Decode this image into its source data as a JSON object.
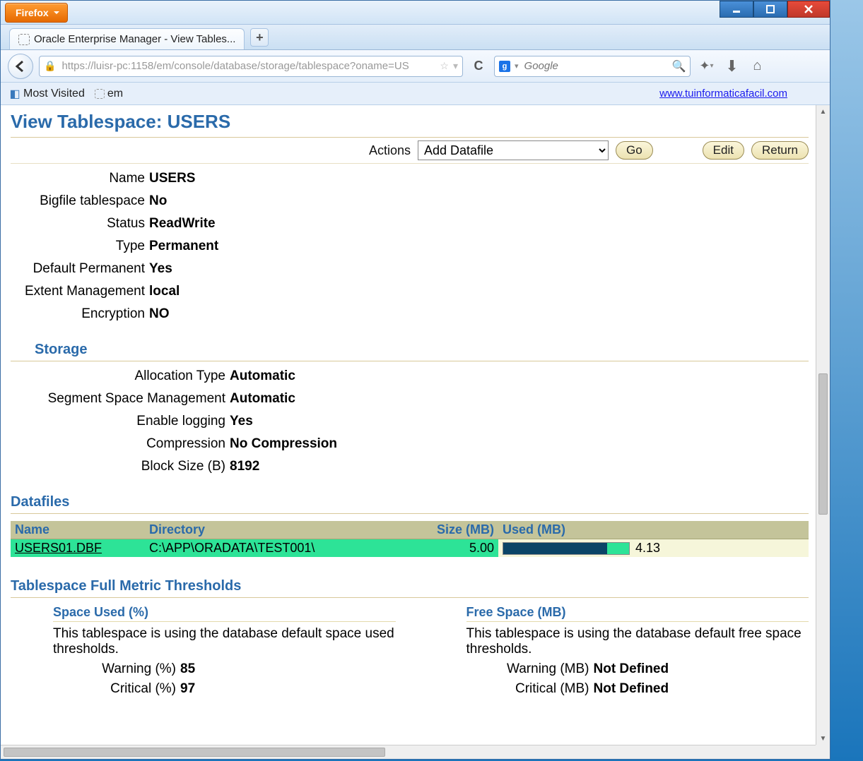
{
  "browser": {
    "menu_button": "Firefox",
    "tab_title": "Oracle Enterprise Manager - View Tables...",
    "url_display": "https://luisr-pc:1158/em/console/database/storage/tablespace?oname=US",
    "search_placeholder": "Google",
    "bookmarks": {
      "most_visited": "Most Visited",
      "em": "em"
    },
    "promo_link": "www.tuinformaticafacil.com"
  },
  "page": {
    "title": "View Tablespace: USERS",
    "actions_label": "Actions",
    "actions_selected": "Add Datafile",
    "btn_go": "Go",
    "btn_edit": "Edit",
    "btn_return": "Return",
    "general": {
      "name_label": "Name",
      "name_value": "USERS",
      "bigfile_label": "Bigfile tablespace",
      "bigfile_value": "No",
      "status_label": "Status",
      "status_value": "ReadWrite",
      "type_label": "Type",
      "type_value": "Permanent",
      "defperm_label": "Default Permanent",
      "defperm_value": "Yes",
      "extent_label": "Extent Management",
      "extent_value": "local",
      "enc_label": "Encryption",
      "enc_value": "NO"
    },
    "storage": {
      "heading": "Storage",
      "alloc_label": "Allocation Type",
      "alloc_value": "Automatic",
      "segspace_label": "Segment Space Management",
      "segspace_value": "Automatic",
      "logging_label": "Enable logging",
      "logging_value": "Yes",
      "comp_label": "Compression",
      "comp_value": "No Compression",
      "block_label": "Block Size (B)",
      "block_value": "8192"
    },
    "datafiles": {
      "heading": "Datafiles",
      "col_name": "Name",
      "col_dir": "Directory",
      "col_size": "Size (MB)",
      "col_used": "Used (MB)",
      "rows": [
        {
          "name": "USERS01.DBF",
          "dir": "C:\\APP\\ORADATA\\TEST001\\",
          "size": "5.00",
          "used": "4.13",
          "used_pct": 82.6
        }
      ]
    },
    "thresholds": {
      "heading": "Tablespace Full Metric Thresholds",
      "space_used": {
        "title": "Space Used (%)",
        "desc": "This tablespace is using the database default space used thresholds.",
        "warn_label": "Warning (%)",
        "warn_value": "85",
        "crit_label": "Critical (%)",
        "crit_value": "97"
      },
      "free_space": {
        "title": "Free Space (MB)",
        "desc": "This tablespace is using the database default free space thresholds.",
        "warn_label": "Warning (MB)",
        "warn_value": "Not Defined",
        "crit_label": "Critical (MB)",
        "crit_value": "Not Defined"
      }
    }
  }
}
